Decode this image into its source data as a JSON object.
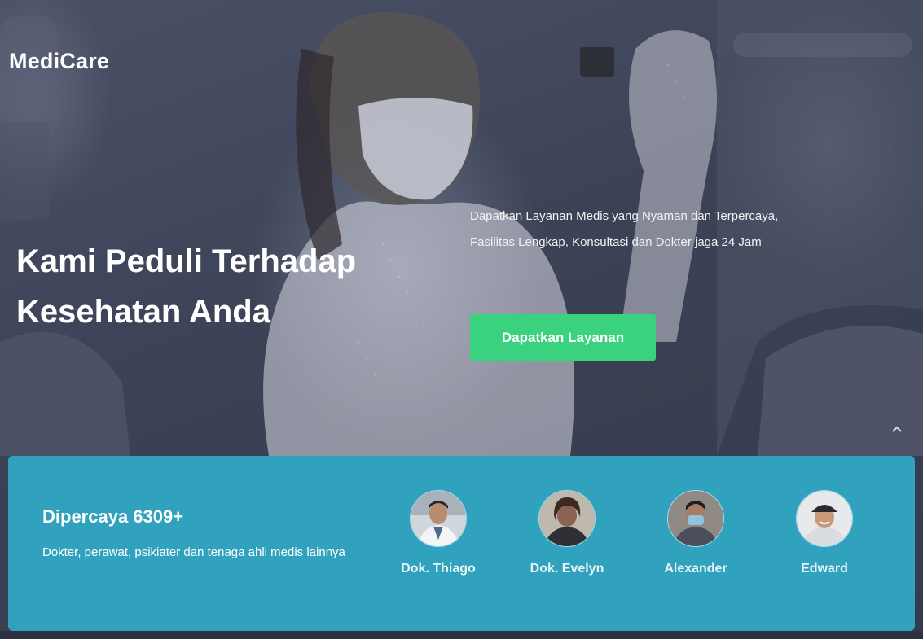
{
  "brand": {
    "name": "MediCare"
  },
  "hero": {
    "headline": "Kami Peduli Terhadap Kesehatan Anda",
    "description": "Dapatkan Layanan Medis yang Nyaman dan Terpercaya, Fasilitas Lengkap, Konsultasi dan Dokter jaga 24 Jam",
    "cta_label": "Dapatkan Layanan",
    "background_image": "doctor-in-mask-holding-xray"
  },
  "scroll_top": {
    "icon": "chevron-up-icon"
  },
  "trust": {
    "title": "Dipercaya 6309+",
    "subtitle": "Dokter, perawat, psikiater dan tenaga ahli medis lainnya",
    "doctors": [
      {
        "name": "Dok. Thiago"
      },
      {
        "name": "Dok. Evelyn"
      },
      {
        "name": "Alexander"
      },
      {
        "name": "Edward"
      }
    ]
  },
  "colors": {
    "accent": "#3ad17f",
    "trust_bg": "#31a2bd",
    "hero_overlay": "#3c4256"
  }
}
